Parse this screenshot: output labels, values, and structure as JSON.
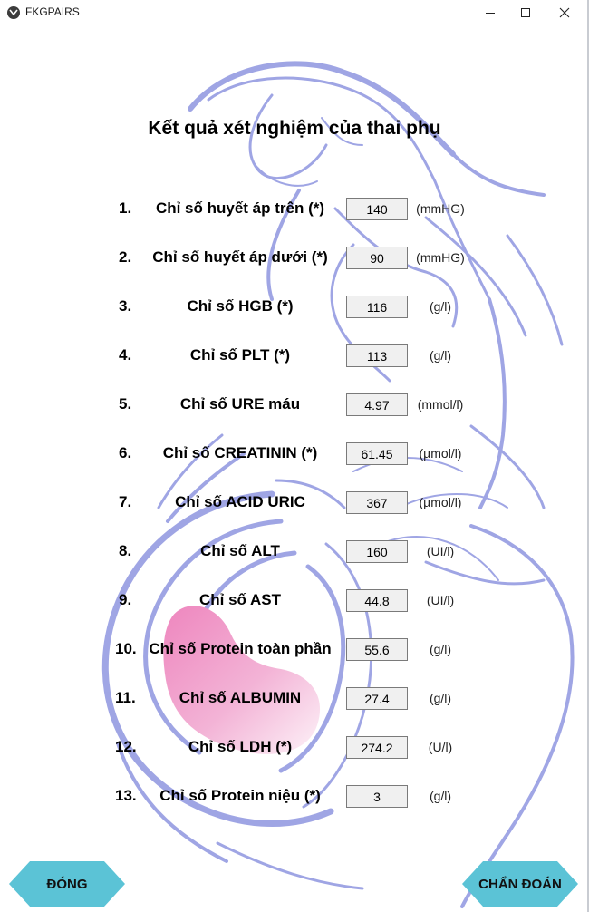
{
  "window": {
    "title": "FKGPAIRS"
  },
  "page": {
    "title": "Kết quả xét nghiệm của thai phụ"
  },
  "rows": [
    {
      "num": "1.",
      "label": "Chỉ số huyết áp trên (*)",
      "value": "140",
      "unit": "(mmHG)"
    },
    {
      "num": "2.",
      "label": "Chỉ số huyết áp dưới (*)",
      "value": "90",
      "unit": "(mmHG)"
    },
    {
      "num": "3.",
      "label": "Chỉ số HGB (*)",
      "value": "116",
      "unit": "(g/l)"
    },
    {
      "num": "4.",
      "label": "Chỉ số PLT (*)",
      "value": "113",
      "unit": "(g/l)"
    },
    {
      "num": "5.",
      "label": "Chỉ số URE máu",
      "value": "4.97",
      "unit": "(mmol/l)"
    },
    {
      "num": "6.",
      "label": "Chỉ số CREATININ (*)",
      "value": "61.45",
      "unit": "(µmol/l)"
    },
    {
      "num": "7.",
      "label": "Chỉ số ACID URIC",
      "value": "367",
      "unit": "(µmol/l)"
    },
    {
      "num": "8.",
      "label": "Chỉ số ALT",
      "value": "160",
      "unit": "(UI/l)"
    },
    {
      "num": "9.",
      "label": "Chỉ số AST",
      "value": "44.8",
      "unit": "(UI/l)"
    },
    {
      "num": "10.",
      "label": "Chỉ số Protein toàn phần",
      "value": "55.6",
      "unit": "(g/l)"
    },
    {
      "num": "11.",
      "label": "Chỉ số ALBUMIN",
      "value": "27.4",
      "unit": "(g/l)"
    },
    {
      "num": "12.",
      "label": "Chỉ số LDH (*)",
      "value": "274.2",
      "unit": "(U/l)"
    },
    {
      "num": "13.",
      "label": "Chỉ số Protein niệu (*)",
      "value": "3",
      "unit": "(g/l)"
    }
  ],
  "buttons": {
    "close_label": "ĐÓNG",
    "diagnose_label": "CHẨN ĐOÁN"
  },
  "colors": {
    "accent": "#5bc3d6",
    "art_stroke": "#8f96e0",
    "art_fill": "#ee86be"
  },
  "icons": {
    "app": "app-logo-icon",
    "minimize": "minimize-icon",
    "maximize": "maximize-icon",
    "close": "close-icon"
  }
}
